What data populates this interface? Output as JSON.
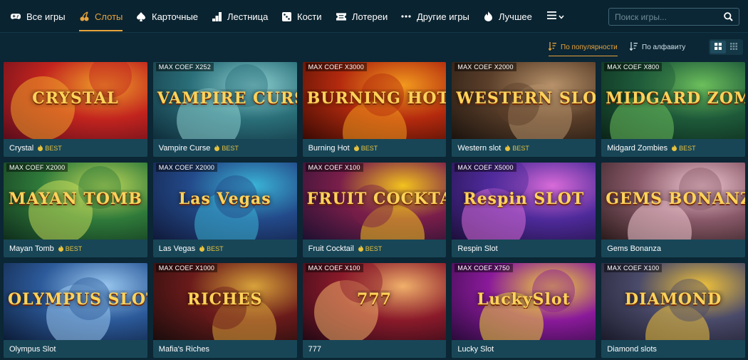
{
  "nav": {
    "items": [
      {
        "label": "Все игры",
        "icon": "gamepad-icon"
      },
      {
        "label": "Слоты",
        "icon": "cherries-icon",
        "active": true
      },
      {
        "label": "Карточные",
        "icon": "spade-icon"
      },
      {
        "label": "Лестница",
        "icon": "ladder-icon"
      },
      {
        "label": "Кости",
        "icon": "dice-icon"
      },
      {
        "label": "Лотереи",
        "icon": "ticket-icon"
      },
      {
        "label": "Другие игры",
        "icon": "dots-icon"
      },
      {
        "label": "Лучшее",
        "icon": "flame-icon"
      }
    ],
    "more_icon": "menu-icon"
  },
  "search": {
    "placeholder": "Поиск игры..."
  },
  "sort": {
    "popular": "По популярности",
    "alpha": "По алфавиту"
  },
  "view": {
    "active": "grid-large"
  },
  "colors": {
    "accent": "#e8a33d",
    "best": "#e8c23d",
    "background": "#0b2634",
    "card": "#184657"
  },
  "games": [
    {
      "name": "Crystal",
      "logo": "CRYSTAL",
      "coef": "",
      "best": "BEST",
      "theme": [
        "#5a0c1c",
        "#c2241e",
        "#f0a02a"
      ]
    },
    {
      "name": "Vampire Curse",
      "logo": "VAMPIRE CURSE",
      "coef": "MAX COEF X252",
      "best": "BEST",
      "theme": [
        "#0f2d3b",
        "#2a6f79",
        "#8ccfd0"
      ]
    },
    {
      "name": "Burning Hot",
      "logo": "BURNING HOT",
      "coef": "MAX COEF X3000",
      "best": "BEST",
      "theme": [
        "#3a0a04",
        "#b42a0e",
        "#f29a1e"
      ]
    },
    {
      "name": "Western slot",
      "logo": "WESTERN SLOT",
      "coef": "MAX COEF X2000",
      "best": "BEST",
      "theme": [
        "#1b130e",
        "#5b3f2a",
        "#b7926a"
      ]
    },
    {
      "name": "Midgard Zombies",
      "logo": "MIDGARD ZOMBIES",
      "coef": "MAX COEF X800",
      "best": "BEST",
      "theme": [
        "#0a2418",
        "#1e5a3a",
        "#6cbf5c"
      ]
    },
    {
      "name": "Mayan Tomb",
      "logo": "MAYAN TOMB",
      "coef": "MAX COEF X2000",
      "best": "BEST",
      "theme": [
        "#0f2e1c",
        "#2f7a3a",
        "#bfd85a"
      ]
    },
    {
      "name": "Las Vegas",
      "logo": "Las Vegas",
      "coef": "MAX COEF X2000",
      "best": "BEST",
      "theme": [
        "#10193a",
        "#234a8a",
        "#3bb4d6"
      ]
    },
    {
      "name": "Fruit Cocktail",
      "logo": "FRUIT COCKTAIL",
      "coef": "MAX COEF X100",
      "best": "BEST",
      "theme": [
        "#1e1030",
        "#7a1e4a",
        "#f2c21e"
      ]
    },
    {
      "name": "Respin Slot",
      "logo": "Respin SLOT",
      "coef": "MAX COEF X5000",
      "best": "",
      "theme": [
        "#1c0f3a",
        "#4e2a9a",
        "#d86bd8"
      ]
    },
    {
      "name": "Gems Bonanza",
      "logo": "GEMS BONANZA",
      "coef": "",
      "best": "",
      "theme": [
        "#2a1a1a",
        "#8a5a6a",
        "#f0c6d0"
      ]
    },
    {
      "name": "Olympus Slot",
      "logo": "OLYMPUS SLOT",
      "coef": "",
      "best": "",
      "theme": [
        "#0c1c38",
        "#2c5a9a",
        "#9ac8f0"
      ]
    },
    {
      "name": "Mafia's Riches",
      "logo": "RICHES",
      "coef": "MAX COEF X1000",
      "best": "",
      "theme": [
        "#1a0c0c",
        "#6a1a1a",
        "#d8a23a"
      ]
    },
    {
      "name": "777",
      "logo": "777",
      "coef": "MAX COEF X100",
      "best": "",
      "theme": [
        "#220814",
        "#8a1a2a",
        "#f0b06a"
      ]
    },
    {
      "name": "Lucky Slot",
      "logo": "LuckySlot",
      "coef": "MAX COEF X750",
      "best": "",
      "theme": [
        "#2a0a3a",
        "#8a1a9a",
        "#f0d23a"
      ]
    },
    {
      "name": "Diamond slots",
      "logo": "DIAMOND",
      "coef": "MAX COEF X100",
      "best": "",
      "theme": [
        "#1a1a2a",
        "#4a4a6a",
        "#f0c23a"
      ]
    }
  ]
}
